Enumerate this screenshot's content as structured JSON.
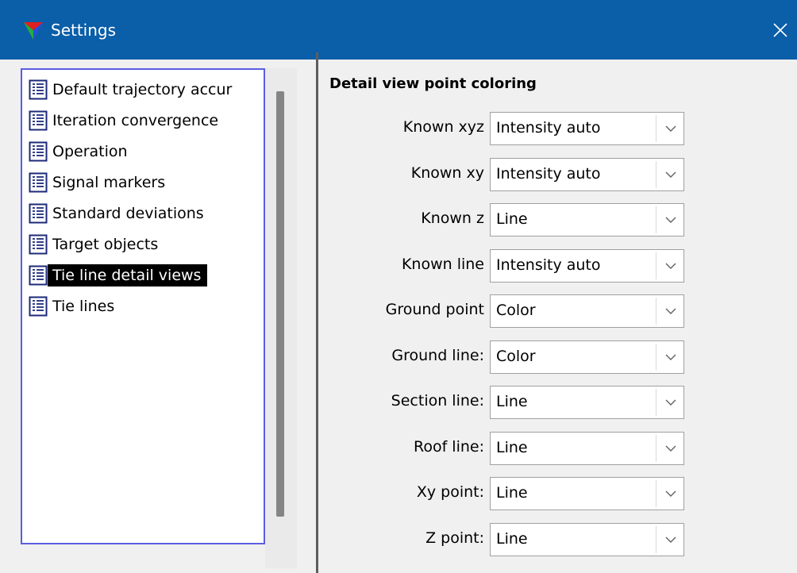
{
  "window": {
    "title": "Settings",
    "close_glyph": "✕",
    "app_icon": "triangle-logo-icon",
    "colors": {
      "titlebar": "#0b5ea8",
      "selection": "#000000",
      "tree_border": "#5a5ee0"
    }
  },
  "sidebar": {
    "items": [
      {
        "label": "Default trajectory accur",
        "icon": "document-list-icon",
        "selected": false
      },
      {
        "label": "Iteration convergence",
        "icon": "document-list-icon",
        "selected": false
      },
      {
        "label": "Operation",
        "icon": "document-list-icon",
        "selected": false
      },
      {
        "label": "Signal markers",
        "icon": "document-list-icon",
        "selected": false
      },
      {
        "label": "Standard deviations",
        "icon": "document-list-icon",
        "selected": false
      },
      {
        "label": "Target objects",
        "icon": "document-list-icon",
        "selected": false
      },
      {
        "label": "Tie line detail views",
        "icon": "document-list-icon",
        "selected": true
      },
      {
        "label": "Tie lines",
        "icon": "document-list-icon",
        "selected": false
      }
    ]
  },
  "main": {
    "section_title": "Detail view point coloring",
    "rows": [
      {
        "label": "Known xyz",
        "value": "Intensity auto"
      },
      {
        "label": "Known xy",
        "value": "Intensity auto"
      },
      {
        "label": "Known z",
        "value": "Line"
      },
      {
        "label": "Known line",
        "value": "Intensity auto"
      },
      {
        "label": "Ground point",
        "value": "Color"
      },
      {
        "label": "Ground line:",
        "value": "Color"
      },
      {
        "label": "Section line:",
        "value": "Line"
      },
      {
        "label": "Roof line:",
        "value": "Line"
      },
      {
        "label": "Xy point:",
        "value": "Line"
      },
      {
        "label": "Z point:",
        "value": "Line"
      }
    ]
  }
}
